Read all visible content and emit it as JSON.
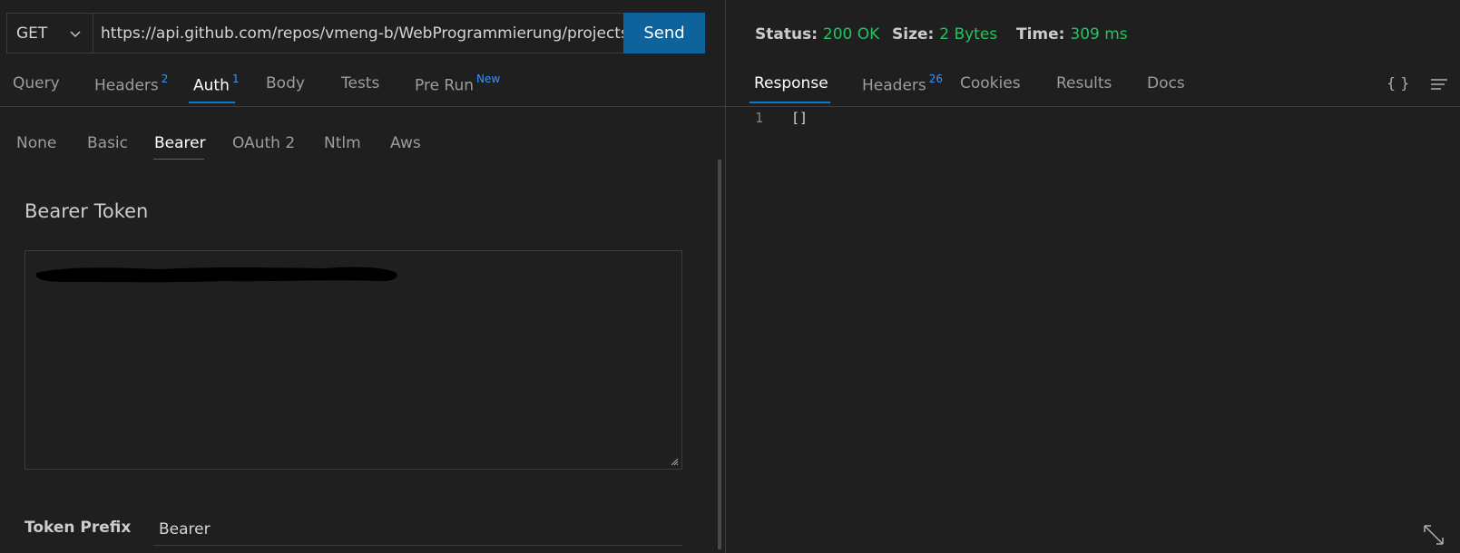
{
  "request": {
    "method": "GET",
    "url": "https://api.github.com/repos/vmeng-b/WebProgrammierung/projects",
    "send_label": "Send"
  },
  "request_tabs": [
    {
      "label": "Query",
      "badge": ""
    },
    {
      "label": "Headers",
      "badge": "2"
    },
    {
      "label": "Auth",
      "badge": "1"
    },
    {
      "label": "Body",
      "badge": ""
    },
    {
      "label": "Tests",
      "badge": ""
    },
    {
      "label": "Pre Run",
      "badge": "New"
    }
  ],
  "active_request_tab": "Auth",
  "auth_tabs": [
    "None",
    "Basic",
    "Bearer",
    "OAuth 2",
    "Ntlm",
    "Aws"
  ],
  "active_auth_tab": "Bearer",
  "bearer": {
    "title": "Bearer Token",
    "token_value_redacted": true,
    "prefix_label": "Token Prefix",
    "prefix_value": "Bearer"
  },
  "response": {
    "status_label": "Status:",
    "status_value": "200 OK",
    "size_label": "Size:",
    "size_value": "2 Bytes",
    "time_label": "Time:",
    "time_value": "309 ms",
    "tabs": [
      {
        "label": "Response",
        "badge": ""
      },
      {
        "label": "Headers",
        "badge": "26"
      },
      {
        "label": "Cookies",
        "badge": ""
      },
      {
        "label": "Results",
        "badge": ""
      },
      {
        "label": "Docs",
        "badge": ""
      }
    ],
    "active_tab": "Response",
    "format_icon_label": "{ }",
    "body_line_number": "1",
    "body_text": "[]"
  },
  "colors": {
    "accent": "#0e639c",
    "tab_underline": "#0e78c9",
    "badge": "#3794ff",
    "status_ok": "#22c55e",
    "background": "#1f1f1f"
  },
  "icons": {
    "method_dropdown": "chevron-down-icon",
    "format_json": "braces-icon",
    "word_wrap": "menu-lines-icon",
    "expand": "expand-icon",
    "resize": "resize-grip-icon"
  }
}
